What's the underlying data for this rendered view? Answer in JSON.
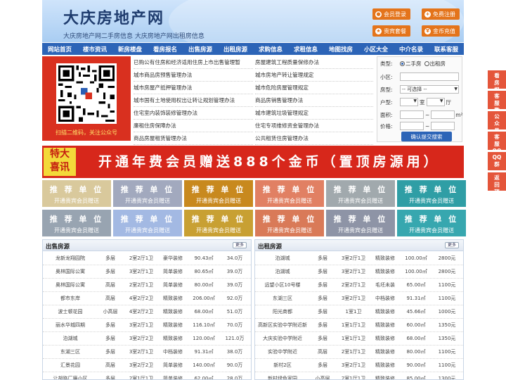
{
  "header": {
    "title": "大庆房地产网",
    "subtitle": "大庆房地产网二手房信息    大庆房地产网出租房信息",
    "buttons": [
      {
        "label": "会员登录",
        "icon": "user-icon"
      },
      {
        "label": "免费注册",
        "icon": "register-icon"
      },
      {
        "label": "贵宾套餐",
        "icon": "vip-icon"
      },
      {
        "label": "金币充值",
        "icon": "coin-icon"
      }
    ]
  },
  "nav": [
    "网站首页",
    "楼市资讯",
    "新房楼盘",
    "看房报名",
    "出售房源",
    "出租房源",
    "求购信息",
    "求租信息",
    "地图找房",
    "小区大全",
    "中介名录",
    "联系客服"
  ],
  "qr": {
    "caption": "扫描二维码，关注公众号"
  },
  "policy": {
    "left": [
      "已购公有住房和经济适用住房上市出售管理暂",
      "城市商品房预售管理办法",
      "城市房屋产抵押管理办法",
      "城市国有土地使用权出让转让规划管理办法",
      "住宅室内装饰装修管理办法",
      "廉租住房保障办法",
      "商品房屋租赁管理办法"
    ],
    "right": [
      "房屋建筑工程质量保修办法",
      "城市房地产转让管理规定",
      "城市危险房屋管理规定",
      "商品房销售管理办法",
      "城市建筑垃圾管理规定",
      "住宅专项维修资金管理办法",
      "公共租赁住房管理办法"
    ]
  },
  "search": {
    "type_label": "类型:",
    "radio_sale": "二手房",
    "radio_rent": "出租房",
    "community_label": "小区:",
    "house_type_label": "房型:",
    "house_type_value": "-- 可选择 --",
    "layout_label": "户型:",
    "room_unit": "室",
    "hall_unit": "厅",
    "area_label": "面积:",
    "area_sep": "~",
    "area_unit": "m²",
    "price_label": "价格:",
    "price_sep": "~",
    "submit": "确认提交搜索"
  },
  "side": [
    "看房报名",
    "客服微信",
    "公众号",
    "客服QQ号",
    "QQ群",
    "返回顶部"
  ],
  "promo": {
    "badge_line1": "特大",
    "badge_line2": "喜讯",
    "text": "开通年费会员赠送888个金币（置顶房源用）"
  },
  "tiles": {
    "title": "推 荐 单 位",
    "sub": "开通贵宾会员赠送",
    "colors": [
      "#d9c99c",
      "#a2a9be",
      "#c8891e",
      "#e18063",
      "#a1a9ad",
      "#2f9ea5",
      "#98a4b1",
      "#a3b9e3",
      "#c8a033",
      "#d97a58",
      "#8e94a6",
      "#37a7af"
    ]
  },
  "sale": {
    "title": "出售房源",
    "more": "更多",
    "rows": [
      [
        "龙新龙翔园院",
        "多层",
        "2室2厅1卫",
        "豪华装修",
        "90.43㎡",
        "34.0万"
      ],
      [
        "奥林国际公寓",
        "多层",
        "3室2厅1卫",
        "简单装修",
        "80.65㎡",
        "39.0万"
      ],
      [
        "奥林国际公寓",
        "高层",
        "2室2厅1卫",
        "简单装修",
        "80.00㎡",
        "39.0万"
      ],
      [
        "都市东岸",
        "高层",
        "4室2厅2卫",
        "精致装修",
        "206.00㎡",
        "92.0万"
      ],
      [
        "波士顿花园",
        "小高层",
        "4室2厅2卫",
        "精致装修",
        "68.00㎡",
        "51.0万"
      ],
      [
        "丽水华城四期",
        "多层",
        "3室2厅1卫",
        "精致装修",
        "116.10㎡",
        "70.0万"
      ],
      [
        "泊湖城",
        "多层",
        "3室2厅2卫",
        "精致装修",
        "120.00㎡",
        "121.0万"
      ],
      [
        "东湖三区",
        "多层",
        "3室2厅1卫",
        "中档装修",
        "91.31㎡",
        "38.0万"
      ],
      [
        "汇景花园",
        "高层",
        "3室2厅2卫",
        "简单装修",
        "140.00㎡",
        "90.0万"
      ],
      [
        "让胡路厂廉小区",
        "多层",
        "2室1厅1卫",
        "简单装修",
        "62.00㎡",
        "28.0万"
      ]
    ]
  },
  "rent": {
    "title": "出租房源",
    "more": "更多",
    "rows": [
      [
        "泊湖城",
        "多层",
        "3室2厅1卫",
        "精致装修",
        "100.00㎡",
        "2800元"
      ],
      [
        "泊湖城",
        "多层",
        "3室2厅1卫",
        "精致装修",
        "100.00㎡",
        "2800元"
      ],
      [
        "远望小区10号楼",
        "多层",
        "2室2厅1卫",
        "毛坯未装",
        "65.00㎡",
        "1100元"
      ],
      [
        "东湖三区",
        "多层",
        "3室2厅1卫",
        "中档装修",
        "91.31㎡",
        "1100元"
      ],
      [
        "阳光商都",
        "多层",
        "1室1卫",
        "精致装修",
        "45.66㎡",
        "1000元"
      ],
      [
        "高新区实验中学附近新",
        "多层",
        "1室1厅1卫",
        "精致装修",
        "60.00㎡",
        "1350元"
      ],
      [
        "大庆实验中学附近",
        "多层",
        "1室1厅1卫",
        "精致装修",
        "68.00㎡",
        "1350元"
      ],
      [
        "实验中学附近",
        "高层",
        "2室1厅1卫",
        "精致装修",
        "80.00㎡",
        "1100元"
      ],
      [
        "新村2区",
        "多层",
        "3室2厅1卫",
        "精致装修",
        "90.00㎡",
        "1100元"
      ],
      [
        "新村绿色家园",
        "小高层",
        "2室1厅1卫",
        "精致装修",
        "85.00㎡",
        "1300元"
      ]
    ]
  }
}
